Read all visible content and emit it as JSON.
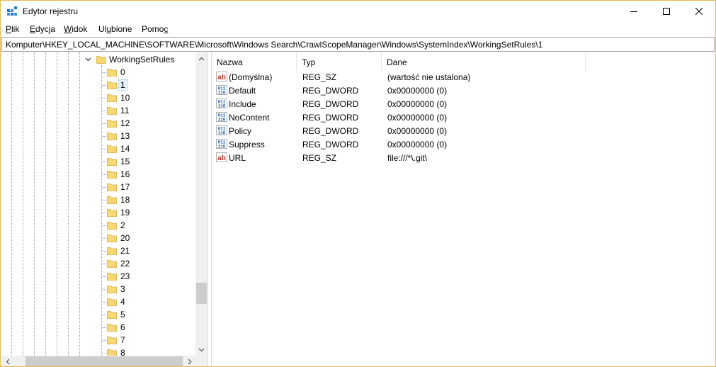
{
  "window": {
    "title": "Edytor rejestru",
    "accent_color": "#e6b84c"
  },
  "menu": [
    {
      "label_pre": "",
      "label_ul": "P",
      "label_post": "lik"
    },
    {
      "label_pre": "",
      "label_ul": "E",
      "label_post": "dycja"
    },
    {
      "label_pre": "",
      "label_ul": "W",
      "label_post": "idok"
    },
    {
      "label_pre": "Ul",
      "label_ul": "u",
      "label_post": "bione"
    },
    {
      "label_pre": "Pomo",
      "label_ul": "c",
      "label_post": ""
    }
  ],
  "address": {
    "path": "Komputer\\HKEY_LOCAL_MACHINE\\SOFTWARE\\Microsoft\\Windows Search\\CrawlScopeManager\\Windows\\SystemIndex\\WorkingSetRules\\1"
  },
  "tree": {
    "parent": {
      "label": "WorkingSetRules",
      "expander": "chevron-down"
    },
    "children": [
      "0",
      "1",
      "10",
      "11",
      "12",
      "13",
      "14",
      "15",
      "16",
      "17",
      "18",
      "19",
      "2",
      "20",
      "21",
      "22",
      "23",
      "3",
      "4",
      "5",
      "6",
      "7",
      "8"
    ],
    "selected": "1",
    "folder_color": "#f8d775"
  },
  "columns": {
    "name": "Nazwa",
    "type": "Typ",
    "data": "Dane"
  },
  "values": [
    {
      "icon": "string-value-icon",
      "name": "(Domyślna)",
      "type": "REG_SZ",
      "data": "(wartość nie ustalona)"
    },
    {
      "icon": "binary-value-icon",
      "name": "Default",
      "type": "REG_DWORD",
      "data": "0x00000000 (0)"
    },
    {
      "icon": "binary-value-icon",
      "name": "Include",
      "type": "REG_DWORD",
      "data": "0x00000000 (0)"
    },
    {
      "icon": "binary-value-icon",
      "name": "NoContent",
      "type": "REG_DWORD",
      "data": "0x00000000 (0)"
    },
    {
      "icon": "binary-value-icon",
      "name": "Policy",
      "type": "REG_DWORD",
      "data": "0x00000000 (0)"
    },
    {
      "icon": "binary-value-icon",
      "name": "Suppress",
      "type": "REG_DWORD",
      "data": "0x00000000 (0)"
    },
    {
      "icon": "string-value-icon",
      "name": "URL",
      "type": "REG_SZ",
      "data": "file:///*\\.git\\"
    }
  ],
  "icon_labels": {
    "string": "ab",
    "binary_top": "011",
    "binary_bottom": "110"
  }
}
